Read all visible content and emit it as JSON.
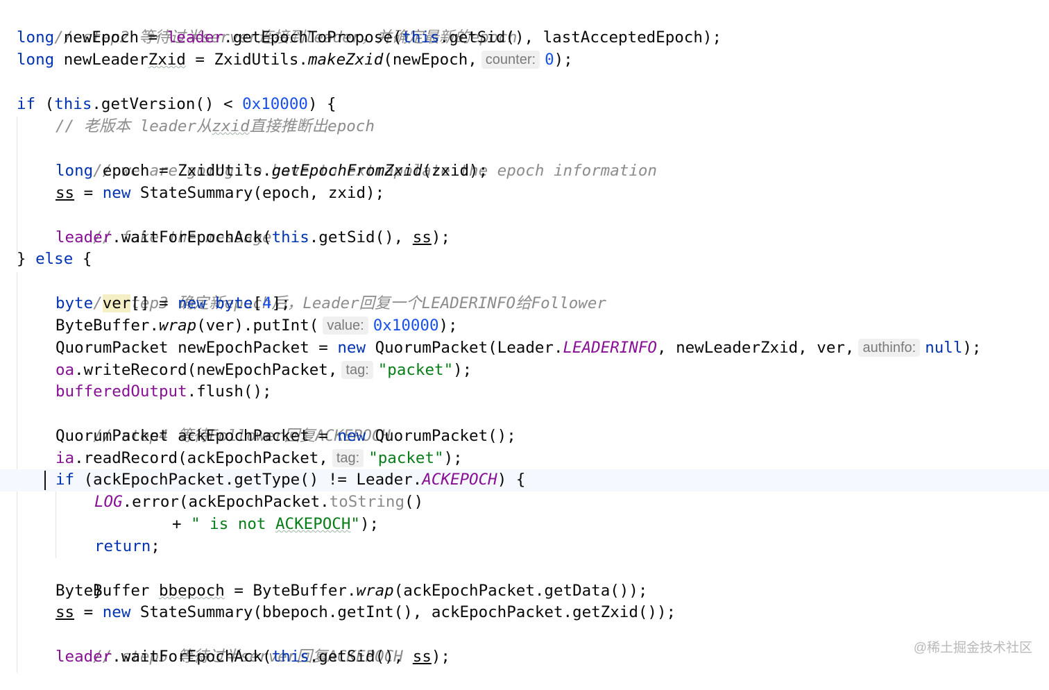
{
  "editor": {
    "lines": {
      "comment_step2": "// step2 等待过半server连接到leader，并确定最新的epoch",
      "new_epoch": {
        "t1": "long",
        "t2": " newEpoch = ",
        "t3": "leader",
        "t4": ".getEpochToPropose(",
        "t5": "this",
        "t6": ".getSid(), lastAcceptedEpoch);"
      },
      "new_leader_zxid": {
        "t1": "long",
        "t2": " newLeader",
        "t3": "Zxid",
        "t4": " = ZxidUtils.",
        "t5": "makeZxid",
        "t6": "(newEpoch,",
        "hint": "counter:",
        "t7": "0",
        "t8": ");"
      },
      "if_version": {
        "t1": "if",
        "t2": " (",
        "t3": "this",
        "t4": ".getVersion() < ",
        "t5": "0x10000",
        "t6": ") {"
      },
      "comment_old_a": "// 老版本 leader从",
      "comment_old_b": "zxid",
      "comment_old_c": "直接推断出epoch",
      "comment_extrapolate": "// we are going to have to extrapolate the epoch information",
      "long_epoch": {
        "t1": "long",
        "t2": " epoch = ZxidUtils.",
        "t3": "getEpochFromZxid",
        "t4": "(zxid);"
      },
      "ss_assign1": {
        "t1": "ss",
        "t2": " = ",
        "t3": "new",
        "t4": " StateSummary(epoch, zxid);"
      },
      "comment_fake": "// fake the message",
      "wait_ack1": {
        "t1": "leader",
        "t2": ".waitForEpochAck(",
        "t3": "this",
        "t4": ".getSid(), ",
        "t5": "ss",
        "t6": ");"
      },
      "else_line": {
        "t1": "} ",
        "t2": "else",
        "t3": " {"
      },
      "comment_step3": "// step3 确定新epoch后，Leader回复一个LEADERINFO给Follower",
      "byte_ver": {
        "t1": "byte",
        "t2": " ",
        "t3": "ver",
        "t4": "[] = ",
        "t5": "new",
        "t6": " ",
        "t7": "byte",
        "t8": "[",
        "t9": "4",
        "t10": "];"
      },
      "byte_buffer_wrap": {
        "t1": "ByteBuffer.",
        "t2": "wrap",
        "t3": "(ver).putInt(",
        "hint": "value:",
        "t4": "0x10000",
        "t5": ");"
      },
      "new_epoch_packet": {
        "t1": "QuorumPacket newEpochPacket = ",
        "t2": "new",
        "t3": " QuorumPacket(Leader.",
        "t4": "LEADERINFO",
        "t5": ", newLeaderZxid, ver,",
        "hint": "authinfo:",
        "t6": "null",
        "t7": ");"
      },
      "write_record": {
        "t1": "oa",
        "t2": ".writeRecord(newEpochPacket,",
        "hint": "tag:",
        "t3": "\"packet\"",
        "t4": ");"
      },
      "flush": {
        "t1": "bufferedOutput",
        "t2": ".flush();"
      },
      "comment_step4": "// step4 等待Follower回复ACKEPOCH",
      "ack_epoch_packet": {
        "t1": "QuorumPacket ackEpochPacket = ",
        "t2": "new",
        "t3": " QuorumPacket();"
      },
      "read_record": {
        "t1": "ia",
        "t2": ".readRecord(ackEpochPacket,",
        "hint": "tag:",
        "t3": "\"packet\"",
        "t4": ");"
      },
      "if_ack_type": {
        "t1": "if",
        "t2": " (ackEpochPacket.getType() != Leader.",
        "t3": "ACKEPOCH",
        "t4": ") {"
      },
      "log_error": {
        "t1": "LOG",
        "t2": ".error(ackEpochPacket.",
        "t3": "toString",
        "t4": "()"
      },
      "log_concat": {
        "t1": "+ ",
        "t2": "\" is not ",
        "t3": "ACKEPOCH",
        "t4": "\"",
        "t5": ");"
      },
      "return_stmt": {
        "t1": "return",
        "t2": ";"
      },
      "close_brace": "}",
      "bbepoch": {
        "t1": "ByteBuffer ",
        "t2": "bbepoch",
        "t3": " = ByteBuffer.",
        "t4": "wrap",
        "t5": "(ackEpochPacket.getData());"
      },
      "ss_assign2": {
        "t1": "ss",
        "t2": " = ",
        "t3": "new",
        "t4": " StateSummary(bbepoch.getInt(), ackEpochPacket.getZxid());"
      },
      "comment_step5": "// step5 等待过半server回复ACKEPOCH",
      "wait_ack2": {
        "t1": "leader",
        "t2": ".waitForEpochAck(",
        "t3": "this",
        "t4": ".getSid(), ",
        "t5": "ss",
        "t6": ");"
      }
    }
  },
  "watermark": "@稀土掘金技术社区",
  "colors": {
    "keyword": "#0033b3",
    "number": "#1750eb",
    "string": "#067d17",
    "comment": "#8c8c8c",
    "field": "#871094",
    "current_line": "#f6f8ff"
  }
}
